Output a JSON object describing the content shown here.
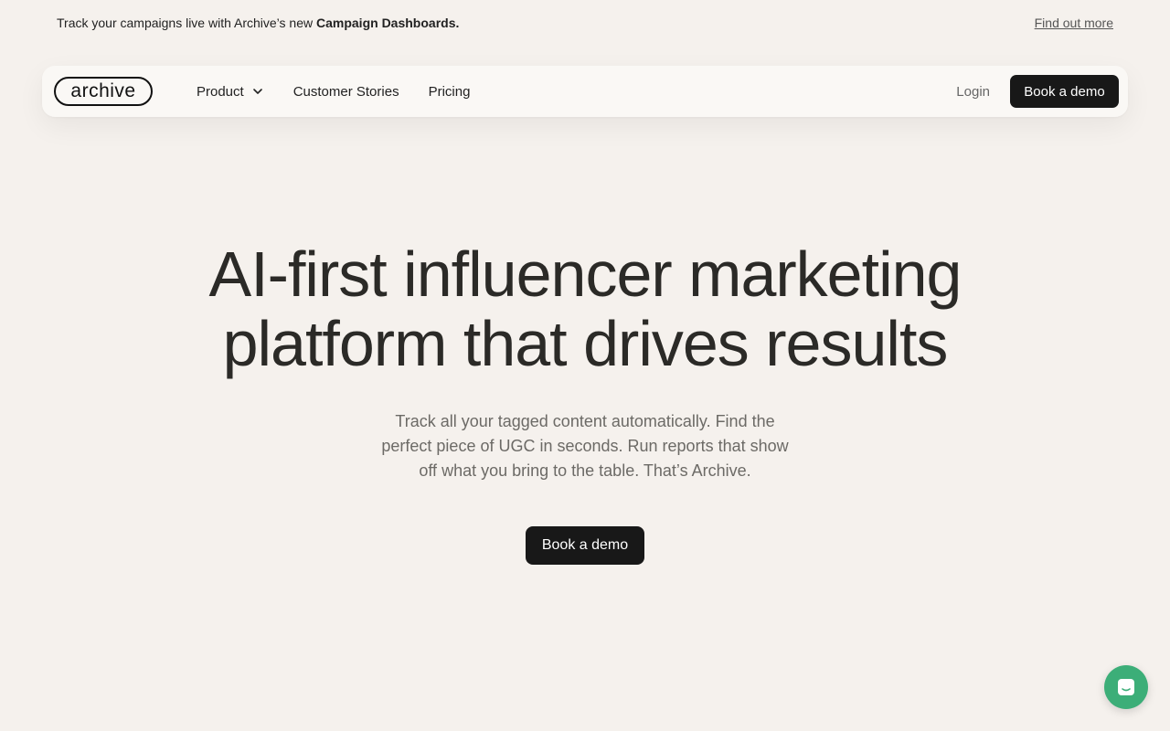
{
  "announcement": {
    "text_prefix": "Track your campaigns live with Archive’s new",
    "text_bold": "Campaign Dashboards.",
    "link": "Find out more"
  },
  "nav": {
    "logo": "archive",
    "items": [
      {
        "label": "Product",
        "icon": "chevron-down-icon"
      },
      {
        "label": "Customer Stories"
      },
      {
        "label": "Pricing"
      }
    ],
    "login": "Login",
    "cta": "Book a demo"
  },
  "hero": {
    "title_line1": "AI-first influencer marketing",
    "title_line2": "platform that drives results",
    "subtitle": "Track all your tagged content automatically. Find the perfect piece of UGC in seconds. Run reports that show off what you bring to the table. That’s Archive.",
    "cta": "Book a demo"
  },
  "chat": {
    "icon": "chat-icon",
    "color": "#3cae78"
  },
  "colors": {
    "background": "#f5f1ed",
    "button": "#181818",
    "accent": "#3cae78"
  }
}
